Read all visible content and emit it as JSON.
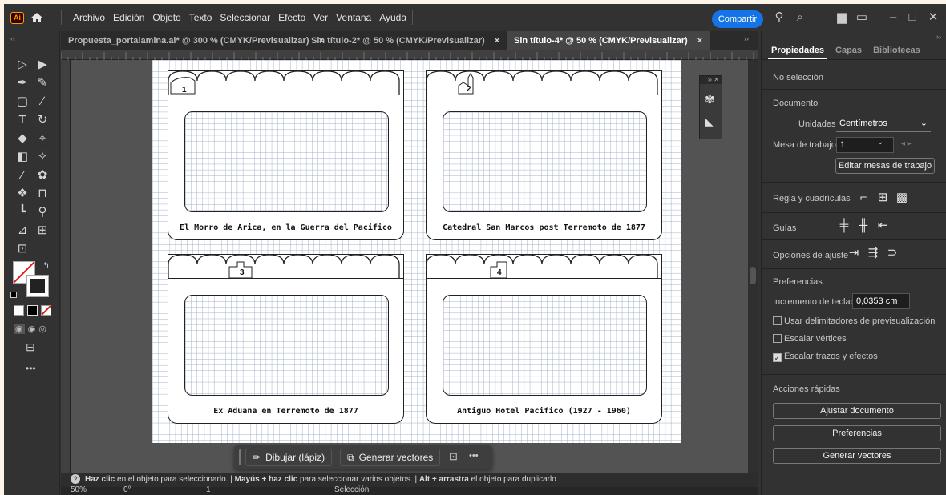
{
  "menubar": {
    "logo": "Ai",
    "items": [
      "Archivo",
      "Edición",
      "Objeto",
      "Texto",
      "Seleccionar",
      "Efecto",
      "Ver",
      "Ventana",
      "Ayuda"
    ],
    "share_label": "Compartir"
  },
  "tabs": [
    {
      "label": "Propuesta_portalamina.ai* @ 300 % (CMYK/Previsualizar)",
      "close": "×"
    },
    {
      "label": "Sin título-2* @ 50 % (CMYK/Previsualizar)",
      "close": "×"
    },
    {
      "label": "Sin título-4* @ 50 % (CMYK/Previsualizar)",
      "close": "×"
    }
  ],
  "cards": [
    {
      "number": "1",
      "caption": "El Morro de Arica, en la Guerra del Pacifico"
    },
    {
      "number": "2",
      "caption": "Catedral San Marcos post Terremoto de 1877"
    },
    {
      "number": "3",
      "caption": "Ex Aduana en Terremoto de 1877"
    },
    {
      "number": "4",
      "caption": "Antiguo Hotel Pacifico (1927 - 1960)"
    }
  ],
  "context_bar": {
    "draw_label": "Dibujar (lápiz)",
    "generate_label": "Generar vectores",
    "more": "•••"
  },
  "status": {
    "message_1": "Haz clic",
    "message_1b": " en el objeto para seleccionarlo.  |  ",
    "message_2": "Mayús + haz clic",
    "message_2b": " para seleccionar varios objetos.  |  ",
    "message_3": "Alt + arrastra",
    "message_3b": " el objeto para duplicarlo."
  },
  "bottom": {
    "zoom": "50%",
    "angle": "0°",
    "artboard": "1",
    "mode": "Selección"
  },
  "panel": {
    "tabs": [
      "Propiedades",
      "Capas",
      "Bibliotecas"
    ],
    "no_selection": "No selección",
    "document": "Documento",
    "units_label": "Unidades:",
    "units_value": "Centímetros",
    "artboard_label": "Mesa de trabajo:",
    "artboard_value": "1",
    "edit_artboards": "Editar mesas de trabajo",
    "rulers_label": "Regla y cuadrículas",
    "guides_label": "Guías",
    "snap_label": "Opciones de ajuste",
    "prefs_header": "Preferencias",
    "keyboard_inc_label": "Incremento de teclado:",
    "keyboard_inc_value": "0,0353 cm",
    "check_preview_bounds": "Usar delimitadores de previsualización",
    "check_scale_corners": "Escalar vértices",
    "check_scale_strokes": "Escalar trazos y efectos",
    "quick_actions": "Acciones rápidas",
    "btn_fit": "Ajustar documento",
    "btn_prefs": "Preferencias",
    "btn_vectors": "Generar vectores"
  },
  "colors": {
    "accent": "#1473e6",
    "app_bg": "#323232",
    "grid": "#9fb0c8"
  }
}
